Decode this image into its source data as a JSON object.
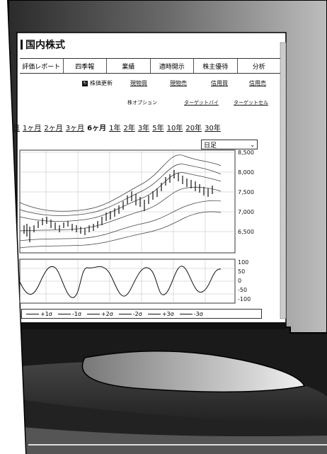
{
  "page": {
    "title": "国内株式"
  },
  "tabs": [
    {
      "label": "評価レポート"
    },
    {
      "label": "四季報"
    },
    {
      "label": "業績"
    },
    {
      "label": "適時開示"
    },
    {
      "label": "株主優待"
    },
    {
      "label": "分析"
    }
  ],
  "toolbar": {
    "refresh_label": "株価更新",
    "links_row1": [
      "現物買",
      "現物売",
      "信用買",
      "信用売"
    ],
    "option_label": "株オプション",
    "links_row2": [
      "ターゲットバイ",
      "ターゲットセル"
    ]
  },
  "periods": [
    {
      "label": "日",
      "active": false
    },
    {
      "label": "1ヶ月",
      "active": false
    },
    {
      "label": "2ヶ月",
      "active": false
    },
    {
      "label": "3ヶ月",
      "active": false
    },
    {
      "label": "6ヶ月",
      "active": true
    },
    {
      "label": "1年",
      "active": false
    },
    {
      "label": "2年",
      "active": false
    },
    {
      "label": "3年",
      "active": false
    },
    {
      "label": "5年",
      "active": false
    },
    {
      "label": "10年",
      "active": false
    },
    {
      "label": "20年",
      "active": false
    },
    {
      "label": "30年",
      "active": false
    }
  ],
  "chart_select": {
    "value": "日足"
  },
  "price_axis": [
    "8,500",
    "8,000",
    "7,500",
    "7,000",
    "6,500"
  ],
  "osc_axis": [
    "100",
    "50",
    "0",
    "-50",
    "-100"
  ],
  "legend": [
    "+1σ",
    "-1σ",
    "+2σ",
    "-2σ",
    "+3σ",
    "-3σ"
  ],
  "icons": {
    "refresh": "refresh-icon",
    "dropdown": "chevron-down-icon"
  }
}
